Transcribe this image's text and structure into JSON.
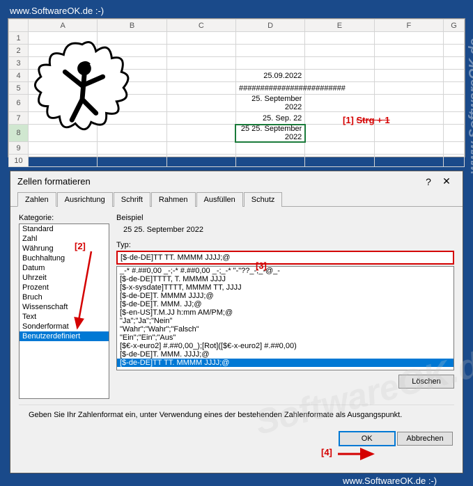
{
  "top_url": "www.SoftwareOK.de :-)",
  "watermarks": [
    "SoftwareOK.de",
    "www.SoftwareOK.de",
    "www.SoftwareOK.de :-)"
  ],
  "sheet": {
    "columns": [
      "A",
      "B",
      "C",
      "D",
      "E",
      "F",
      "G"
    ],
    "rows": [
      {
        "n": 1,
        "D": ""
      },
      {
        "n": 2,
        "D": ""
      },
      {
        "n": 3,
        "D": ""
      },
      {
        "n": 4,
        "D": "25.09.2022"
      },
      {
        "n": 5,
        "D": "#########################"
      },
      {
        "n": 6,
        "D": "25. September 2022"
      },
      {
        "n": 7,
        "D": "25. Sep. 22"
      },
      {
        "n": 8,
        "D": "25 25. September 2022",
        "selected": true
      },
      {
        "n": 9,
        "D": ""
      },
      {
        "n": 10,
        "D": ""
      }
    ],
    "annotation1": "[1]",
    "annotation1b": "Strg + 1"
  },
  "dialog": {
    "title": "Zellen formatieren",
    "tabs": [
      "Zahlen",
      "Ausrichtung",
      "Schrift",
      "Rahmen",
      "Ausfüllen",
      "Schutz"
    ],
    "active_tab": 0,
    "category_label": "Kategorie:",
    "categories": [
      "Standard",
      "Zahl",
      "Währung",
      "Buchhaltung",
      "Datum",
      "Uhrzeit",
      "Prozent",
      "Bruch",
      "Wissenschaft",
      "Text",
      "Sonderformat",
      "Benutzerdefiniert"
    ],
    "category_selected": 11,
    "sample_label": "Beispiel",
    "sample_value": "25 25. September 2022",
    "type_label": "Typ:",
    "type_value": "[$-de-DE]TT TT. MMMM JJJJ;@",
    "formats": [
      "_-* #.##0,00 _-;-* #.##0,00 _-;_-* \"-\"??_-;_-@_-",
      "[$-de-DE]TTTT, T. MMMM JJJJ",
      "[$-x-sysdate]TTTT, MMMM TT, JJJJ",
      "[$-de-DE]T. MMMM JJJJ;@",
      "[$-de-DE]T. MMM. JJ;@",
      "[$-en-US]T.M.JJ h:mm AM/PM;@",
      "\"Ja\";\"Ja\";\"Nein\"",
      "\"Wahr\";\"Wahr\";\"Falsch\"",
      "\"Ein\";\"Ein\";\"Aus\"",
      "[$€-x-euro2] #.##0,00_);[Rot]([$€-x-euro2] #.##0,00)",
      "[$-de-DE]T. MMM. JJJJ;@",
      "[$-de-DE]TT TT. MMMM JJJJ;@"
    ],
    "format_selected": 11,
    "delete_btn": "Löschen",
    "hint": "Geben Sie Ihr Zahlenformat ein, unter Verwendung eines der bestehenden Zahlenformate als Ausgangspunkt.",
    "ok_btn": "OK",
    "cancel_btn": "Abbrechen",
    "annotation2": "[2]",
    "annotation3": "[3]",
    "annotation4": "[4]"
  }
}
